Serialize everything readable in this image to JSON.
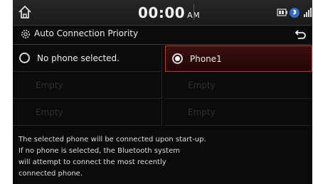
{
  "statusbar": {
    "time": "00:00",
    "ampm": "AM"
  },
  "header": {
    "title": "Auto Connection Priority"
  },
  "options": [
    {
      "label": "No phone selected.",
      "selected": false
    },
    {
      "label": "Phone1",
      "selected": true
    }
  ],
  "empty_slots": [
    "Empty",
    "Empty",
    "Empty",
    "Empty"
  ],
  "description": [
    "The selected phone will be connected upon start-up.",
    "If no phone is selected, the Bluetooth system",
    "will attempt to connect the most recently",
    "connected phone."
  ],
  "colors": {
    "accent": "#c0392b",
    "background": "#0b0b0b"
  }
}
